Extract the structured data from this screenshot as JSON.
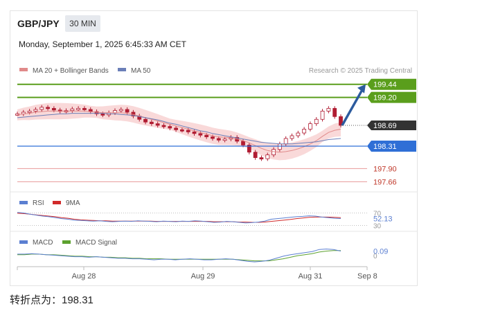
{
  "header": {
    "pair": "GBP/JPY",
    "timeframe": "30 MIN",
    "datetime": "Monday, September 1, 2025 6:45:33 AM CET"
  },
  "footer": {
    "pivot_text": "转折点为：198.31"
  },
  "colors": {
    "up_green": "#5a9e1c",
    "pivot_blue": "#2f6fd6",
    "support_red": "#c0392b",
    "candle": "#b01c32",
    "bollinger_fill": "#f7c9c9",
    "ma20": "#e08a8a",
    "ma50": "#6b7fb8",
    "rsi": "#5b7fd1",
    "rsi_ma": "#d12a2a",
    "macd": "#5b7fd1",
    "macd_signal": "#5ca12e",
    "arrow": "#2c5b9e",
    "current_price_bg": "#333333"
  },
  "chart_data": [
    {
      "type": "line",
      "panel": "price",
      "legend": [
        "MA 20 + Bollinger Bands",
        "MA 50"
      ],
      "source_note": "Research © 2025 Trading Central",
      "x_ticks": [
        "Aug 28",
        "Aug 29",
        "Aug 31",
        "Sep 8"
      ],
      "ylim": [
        197.5,
        199.55
      ],
      "levels": [
        {
          "value": 199.44,
          "label": "199.44",
          "kind": "resistance"
        },
        {
          "value": 199.2,
          "label": "199.20",
          "kind": "resistance"
        },
        {
          "value": 198.69,
          "label": "198.69",
          "kind": "current"
        },
        {
          "value": 198.31,
          "label": "198.31",
          "kind": "pivot"
        },
        {
          "value": 197.9,
          "label": "197.90",
          "kind": "support"
        },
        {
          "value": 197.66,
          "label": "197.66",
          "kind": "support"
        }
      ],
      "arrow": {
        "from": 198.69,
        "to": 199.44
      },
      "series": [
        {
          "name": "Price",
          "values": [
            198.9,
            198.93,
            198.95,
            198.98,
            199.02,
            199.0,
            198.97,
            198.95,
            198.96,
            198.99,
            199.0,
            198.98,
            198.94,
            198.9,
            198.88,
            198.92,
            198.96,
            198.98,
            198.93,
            198.86,
            198.8,
            198.75,
            198.72,
            198.69,
            198.67,
            198.64,
            198.61,
            198.6,
            198.57,
            198.54,
            198.51,
            198.48,
            198.45,
            198.42,
            198.44,
            198.47,
            198.4,
            198.33,
            198.2,
            198.1,
            198.08,
            198.15,
            198.25,
            198.35,
            198.45,
            198.5,
            198.55,
            198.62,
            198.72,
            198.8,
            198.95,
            199.0,
            198.85,
            198.69
          ]
        },
        {
          "name": "MA 20",
          "values": [
            198.88,
            198.9,
            198.91,
            198.93,
            198.94,
            198.95,
            198.95,
            198.95,
            198.95,
            198.95,
            198.95,
            198.95,
            198.94,
            198.93,
            198.92,
            198.92,
            198.92,
            198.92,
            198.91,
            198.89,
            198.86,
            198.83,
            198.8,
            198.77,
            198.74,
            198.71,
            198.68,
            198.65,
            198.62,
            198.59,
            198.56,
            198.53,
            198.5,
            198.48,
            198.47,
            198.46,
            198.44,
            198.41,
            198.37,
            198.32,
            198.27,
            198.23,
            198.21,
            198.2,
            198.21,
            198.23,
            198.26,
            198.3,
            198.35,
            198.41,
            198.49,
            198.56,
            198.6,
            198.62
          ]
        },
        {
          "name": "MA 50",
          "values": [
            198.83,
            198.84,
            198.85,
            198.86,
            198.87,
            198.88,
            198.89,
            198.9,
            198.9,
            198.91,
            198.91,
            198.91,
            198.91,
            198.91,
            198.91,
            198.9,
            198.9,
            198.89,
            198.88,
            198.87,
            198.85,
            198.83,
            198.81,
            198.79,
            198.76,
            198.73,
            198.71,
            198.68,
            198.65,
            198.62,
            198.59,
            198.57,
            198.54,
            198.52,
            198.5,
            198.48,
            198.46,
            198.44,
            198.42,
            198.4,
            198.38,
            198.37,
            198.36,
            198.35,
            198.35,
            198.35,
            198.36,
            198.37,
            198.38,
            198.39,
            198.41,
            198.43,
            198.44,
            198.45
          ]
        }
      ]
    },
    {
      "type": "line",
      "panel": "rsi",
      "legend": [
        "RSI",
        "9MA"
      ],
      "levels": [
        70,
        30
      ],
      "current_label": "52.13",
      "ylim": [
        20,
        80
      ],
      "series": [
        {
          "name": "RSI",
          "values": [
            72,
            70,
            66,
            63,
            60,
            58,
            55,
            52,
            50,
            47,
            46,
            45,
            44,
            45,
            43,
            42,
            43,
            44,
            43,
            45,
            44,
            43,
            42,
            44,
            43,
            42,
            44,
            43,
            45,
            44,
            42,
            40,
            41,
            43,
            42,
            40,
            38,
            39,
            41,
            44,
            50,
            52,
            54,
            56,
            58,
            59,
            61,
            60,
            57,
            55,
            53,
            52.13
          ]
        },
        {
          "name": "9MA",
          "values": [
            69,
            68,
            66,
            64,
            62,
            60,
            58,
            55,
            53,
            50,
            48,
            47,
            46,
            45,
            45,
            44,
            44,
            44,
            44,
            44,
            44,
            44,
            43,
            43,
            43,
            43,
            43,
            43,
            43,
            43,
            43,
            42,
            42,
            42,
            42,
            41,
            41,
            40,
            40,
            41,
            43,
            45,
            47,
            49,
            52,
            54,
            56,
            57,
            57,
            57,
            56,
            55
          ]
        }
      ]
    },
    {
      "type": "line",
      "panel": "macd",
      "legend": [
        "MACD",
        "MACD Signal"
      ],
      "current_label": "0.09",
      "ylim": [
        -0.2,
        0.15
      ],
      "series": [
        {
          "name": "MACD",
          "values": [
            0.03,
            0.03,
            0.04,
            0.03,
            0.02,
            0.01,
            0.0,
            -0.01,
            -0.02,
            -0.02,
            -0.03,
            -0.02,
            -0.03,
            -0.04,
            -0.05,
            -0.05,
            -0.06,
            -0.06,
            -0.07,
            -0.08,
            -0.07,
            -0.07,
            -0.08,
            -0.07,
            -0.06,
            -0.07,
            -0.08,
            -0.08,
            -0.07,
            -0.06,
            -0.07,
            -0.09,
            -0.11,
            -0.12,
            -0.11,
            -0.09,
            -0.05,
            -0.01,
            0.02,
            0.04,
            0.06,
            0.08,
            0.12,
            0.13,
            0.12,
            0.09
          ]
        },
        {
          "name": "MACD Signal",
          "values": [
            0.02,
            0.02,
            0.03,
            0.03,
            0.02,
            0.02,
            0.01,
            0.0,
            -0.01,
            -0.01,
            -0.02,
            -0.02,
            -0.03,
            -0.03,
            -0.04,
            -0.04,
            -0.05,
            -0.05,
            -0.06,
            -0.06,
            -0.06,
            -0.07,
            -0.07,
            -0.07,
            -0.07,
            -0.07,
            -0.07,
            -0.07,
            -0.07,
            -0.07,
            -0.07,
            -0.08,
            -0.09,
            -0.1,
            -0.1,
            -0.1,
            -0.08,
            -0.06,
            -0.03,
            0.0,
            0.02,
            0.04,
            0.07,
            0.09,
            0.1,
            0.1
          ]
        }
      ]
    }
  ]
}
